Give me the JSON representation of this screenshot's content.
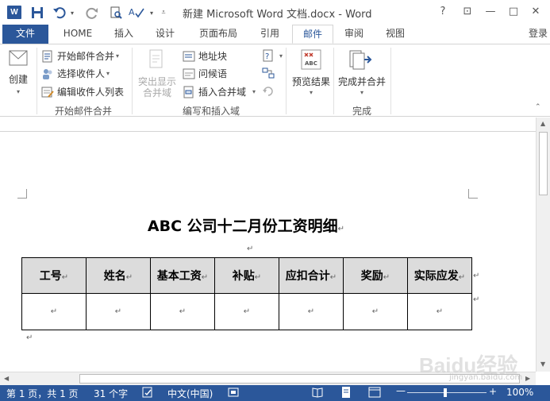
{
  "window": {
    "title": "新建 Microsoft Word 文档.docx - Word",
    "logo_text": "W",
    "controls": [
      "?",
      "⊡",
      "—",
      "□",
      "✕"
    ]
  },
  "tabs": {
    "file": "文件",
    "home": "HOME",
    "insert": "插入",
    "design": "设计",
    "layout": "页面布局",
    "references": "引用",
    "mailings": "邮件",
    "review": "审阅",
    "view": "视图",
    "active": "邮件"
  },
  "account": {
    "login": "登录"
  },
  "ribbon": {
    "create": {
      "label": "创建"
    },
    "start_group": {
      "items": [
        "开始邮件合并",
        "选择收件人",
        "编辑收件人列表"
      ],
      "group_label": "开始邮件合并"
    },
    "write_group": {
      "highlight": "突出显示\n合并域",
      "highlight_line1": "突出显示",
      "highlight_line2": "合并域",
      "items": [
        "地址块",
        "问候语",
        "插入合并域"
      ],
      "group_label": "编写和插入域"
    },
    "preview": {
      "label": "预览结果",
      "icon_text": "ABC"
    },
    "finish": {
      "label": "完成并合并",
      "group_label": "完成"
    }
  },
  "document": {
    "title": "ABC 公司十二月份工资明细",
    "paragraph_mark": "↵",
    "table": {
      "headers": [
        "工号",
        "姓名",
        "基本工资",
        "补贴",
        "应扣合计",
        "奖励",
        "实际应发"
      ],
      "row": [
        "↵",
        "↵",
        "↵",
        "↵",
        "↵",
        "↵",
        "↵"
      ]
    }
  },
  "statusbar": {
    "page": "第 1 页，共 1 页",
    "words": "31 个字",
    "language": "中文(中国)",
    "zoom": "100%",
    "zoom_minus": "—",
    "zoom_plus": "+"
  },
  "watermark": {
    "text": "Baidu经验",
    "sub": "jingyan.baidu.com"
  },
  "colors": {
    "accent": "#2b579a",
    "table_header_bg": "#dcdcdc"
  }
}
